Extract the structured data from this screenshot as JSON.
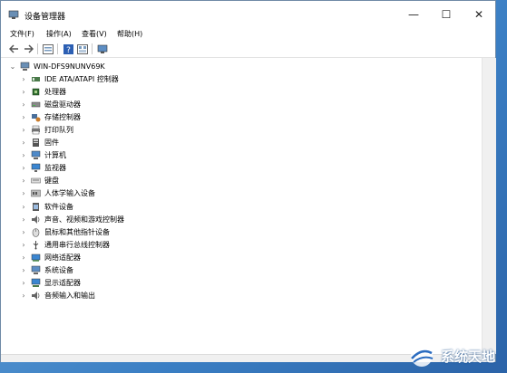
{
  "window": {
    "title": "设备管理器"
  },
  "titlebar_buttons": {
    "minimize": "—",
    "maximize": "☐",
    "close": "✕"
  },
  "menu": [
    {
      "label": "文件(F)"
    },
    {
      "label": "操作(A)"
    },
    {
      "label": "查看(V)"
    },
    {
      "label": "帮助(H)"
    }
  ],
  "toolbar_icons": [
    "back-arrow-icon",
    "forward-arrow-icon",
    "properties-icon",
    "help-icon",
    "view-icon",
    "monitor-scan-icon"
  ],
  "tree": {
    "root": {
      "label": "WIN-DFS9NUNV69K",
      "expanded": true,
      "icon": "computer-icon"
    },
    "items": [
      {
        "label": "IDE ATA/ATAPI 控制器",
        "icon": "ide-controller-icon"
      },
      {
        "label": "处理器",
        "icon": "processor-icon"
      },
      {
        "label": "磁盘驱动器",
        "icon": "disk-drive-icon"
      },
      {
        "label": "存储控制器",
        "icon": "storage-controller-icon"
      },
      {
        "label": "打印队列",
        "icon": "printer-icon"
      },
      {
        "label": "固件",
        "icon": "firmware-icon"
      },
      {
        "label": "计算机",
        "icon": "computer-icon"
      },
      {
        "label": "监视器",
        "icon": "monitor-icon"
      },
      {
        "label": "键盘",
        "icon": "keyboard-icon"
      },
      {
        "label": "人体学输入设备",
        "icon": "hid-icon"
      },
      {
        "label": "软件设备",
        "icon": "software-device-icon"
      },
      {
        "label": "声音、视频和游戏控制器",
        "icon": "sound-icon"
      },
      {
        "label": "鼠标和其他指针设备",
        "icon": "mouse-icon"
      },
      {
        "label": "通用串行总线控制器",
        "icon": "usb-icon"
      },
      {
        "label": "网络适配器",
        "icon": "network-adapter-icon"
      },
      {
        "label": "系统设备",
        "icon": "system-device-icon"
      },
      {
        "label": "显示适配器",
        "icon": "display-adapter-icon"
      },
      {
        "label": "音频输入和输出",
        "icon": "audio-io-icon"
      }
    ]
  },
  "watermark": {
    "text": "系统天地"
  },
  "colors": {
    "accent": "#3b7fc4",
    "window_border": "#6f8aa6"
  }
}
